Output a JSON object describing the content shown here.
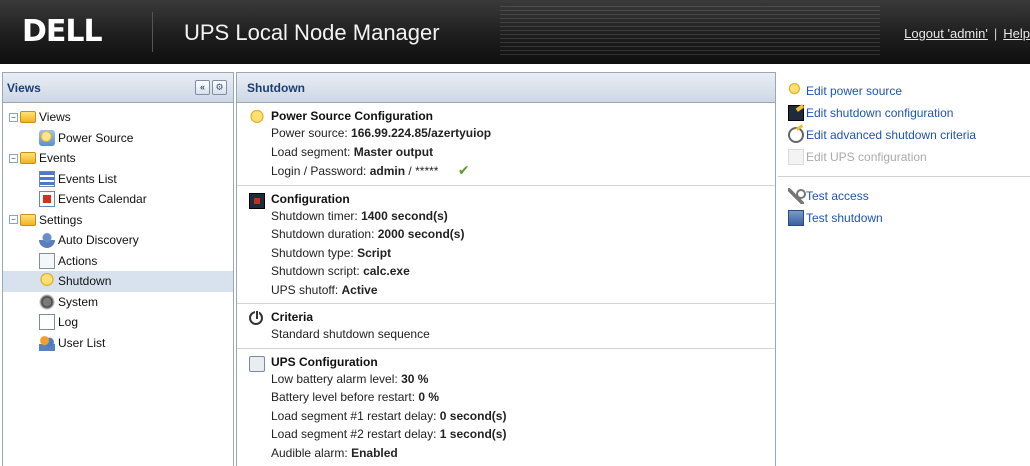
{
  "header": {
    "brand": "DELL",
    "title": "UPS Local Node Manager",
    "logout_label": "Logout 'admin'",
    "separator": "|",
    "help_label": "Help"
  },
  "left_panel": {
    "title": "Views",
    "collapse_glyph": "«",
    "settings_glyph": "⚙",
    "tree": [
      {
        "label": "Views",
        "level": 0,
        "expandable": true,
        "icon": "folder-icon"
      },
      {
        "label": "Power Source",
        "level": 1,
        "icon": "power-source-icon"
      },
      {
        "label": "Events",
        "level": 0,
        "expandable": true,
        "icon": "folder-icon"
      },
      {
        "label": "Events List",
        "level": 1,
        "icon": "events-list-icon"
      },
      {
        "label": "Events Calendar",
        "level": 1,
        "icon": "events-calendar-icon"
      },
      {
        "label": "Settings",
        "level": 0,
        "expandable": true,
        "icon": "folder-icon"
      },
      {
        "label": "Auto Discovery",
        "level": 1,
        "icon": "auto-discovery-icon"
      },
      {
        "label": "Actions",
        "level": 1,
        "icon": "actions-icon"
      },
      {
        "label": "Shutdown",
        "level": 1,
        "icon": "shutdown-icon",
        "selected": true
      },
      {
        "label": "System",
        "level": 1,
        "icon": "system-icon"
      },
      {
        "label": "Log",
        "level": 1,
        "icon": "log-icon"
      },
      {
        "label": "User List",
        "level": 1,
        "icon": "user-list-icon"
      }
    ]
  },
  "main": {
    "title": "Shutdown",
    "power_source": {
      "title": "Power Source Configuration",
      "source_label": "Power source:",
      "source_value": "166.99.224.85/azertyuiop",
      "segment_label": "Load segment:",
      "segment_value": "Master output",
      "login_label": "Login / Password:",
      "login_user": "admin",
      "login_sep": "/",
      "login_pass": "*****",
      "check": "✔"
    },
    "configuration": {
      "title": "Configuration",
      "timer_label": "Shutdown timer:",
      "timer_value": "1400 second(s)",
      "duration_label": "Shutdown duration:",
      "duration_value": "2000 second(s)",
      "type_label": "Shutdown type:",
      "type_value": "Script",
      "script_label": "Shutdown script:",
      "script_value": "calc.exe",
      "shutoff_label": "UPS shutoff:",
      "shutoff_value": "Active"
    },
    "criteria": {
      "title": "Criteria",
      "text": "Standard shutdown sequence"
    },
    "ups_configuration": {
      "title": "UPS Configuration",
      "low_battery_label": "Low battery alarm level:",
      "low_battery_value": "30 %",
      "restart_battery_label": "Battery level before restart:",
      "restart_battery_value": "0 %",
      "seg1_label": "Load segment #1 restart delay:",
      "seg1_value": "0 second(s)",
      "seg2_label": "Load segment #2 restart delay:",
      "seg2_value": "1 second(s)",
      "alarm_label": "Audible alarm:",
      "alarm_value": "Enabled"
    }
  },
  "right_panel": {
    "actions": [
      {
        "label": "Edit power source",
        "enabled": true
      },
      {
        "label": "Edit shutdown configuration",
        "enabled": true
      },
      {
        "label": "Edit advanced shutdown criteria",
        "enabled": true
      },
      {
        "label": "Edit UPS configuration",
        "enabled": false
      }
    ],
    "tests": [
      {
        "label": "Test access",
        "enabled": true
      },
      {
        "label": "Test shutdown",
        "enabled": true
      }
    ]
  },
  "colors": {
    "header_bg": "#1e1e1e",
    "panel_header_text": "#1b3f75",
    "link": "#1e55b3",
    "disabled": "#aaaaaa",
    "check": "#5a9e2a",
    "selected_row": "#d8e2ef"
  }
}
